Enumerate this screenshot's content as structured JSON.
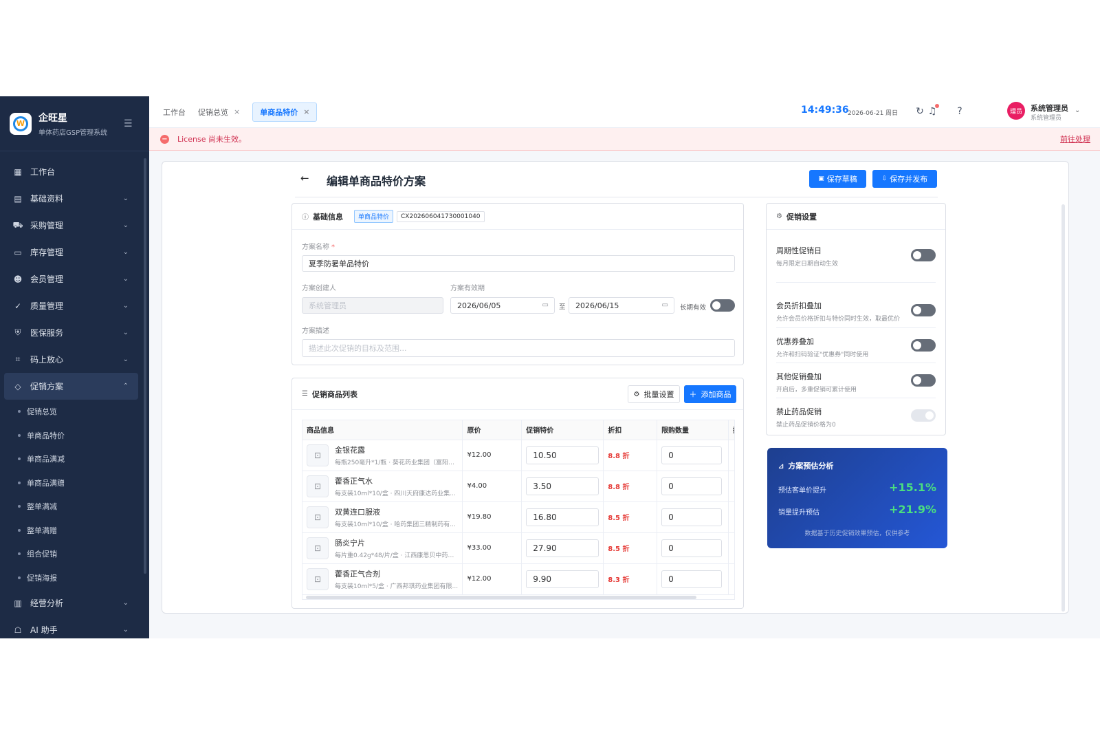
{
  "brand": {
    "name": "企旺星",
    "subtitle": "单体药店GSP管理系统"
  },
  "sidebar": {
    "items": [
      {
        "label": "工作台",
        "icon": "dashboard-icon"
      },
      {
        "label": "基础资料",
        "icon": "grid-icon"
      },
      {
        "label": "采购管理",
        "icon": "cart-icon"
      },
      {
        "label": "库存管理",
        "icon": "inventory-icon"
      },
      {
        "label": "会员管理",
        "icon": "users-icon"
      },
      {
        "label": "质量管理",
        "icon": "check-badge-icon"
      },
      {
        "label": "医保服务",
        "icon": "shield-icon"
      },
      {
        "label": "码上放心",
        "icon": "qr-icon"
      },
      {
        "label": "促销方案",
        "icon": "tag-icon"
      }
    ],
    "promo_sub": [
      "促销总览",
      "单商品特价",
      "单商品满减",
      "单商品满赠",
      "整单满减",
      "整单满赠",
      "组合促销",
      "促销海报"
    ],
    "bottom_items": [
      {
        "label": "经营分析",
        "icon": "chart-icon"
      },
      {
        "label": "AI 助手",
        "icon": "robot-icon"
      }
    ]
  },
  "tabs": [
    {
      "label": "工作台"
    },
    {
      "label": "促销总览"
    },
    {
      "label": "单商品特价"
    }
  ],
  "header": {
    "time": "14:49:36",
    "date": "2026-06-21 周日",
    "avatar_text": "理员",
    "user_name": "系统管理员",
    "user_role": "系统管理员"
  },
  "alert": {
    "text": "License 尚未生效。",
    "link": "前往处理"
  },
  "page": {
    "title": "编辑单商品特价方案",
    "save_draft": "保存草稿",
    "save_publish": "保存并发布"
  },
  "basic": {
    "title": "基础信息",
    "type_tag": "单商品特价",
    "code": "CX202606041730001040",
    "name_label": "方案名称",
    "name_value": "夏季防暑单品特价",
    "creator_label": "方案创建人",
    "creator_value": "系统管理员",
    "period_label": "方案有效期",
    "start_date": "2026/06/05",
    "to": "至",
    "end_date": "2026/06/15",
    "long_term": "长期有效",
    "desc_label": "方案描述",
    "desc_placeholder": "描述此次促销的目标及范围..."
  },
  "list": {
    "title": "促销商品列表",
    "batch": "批量设置",
    "add": "添加商品",
    "headers": [
      "商品信息",
      "原价",
      "促销特价",
      "折扣",
      "限购数量",
      "操"
    ],
    "rows": [
      {
        "name": "金银花露",
        "spec": "每瓶250毫升*1/瓶 · 葵花药业集团（富阳）...",
        "price": "¥12.00",
        "promo": "10.50",
        "discount": "8.8 折",
        "limit": "0"
      },
      {
        "name": "藿香正气水",
        "spec": "每支装10ml*10/盒 · 四川天府康达药业集...",
        "price": "¥4.00",
        "promo": "3.50",
        "discount": "8.8 折",
        "limit": "0"
      },
      {
        "name": "双黄连口服液",
        "spec": "每支装10ml*10/盒 · 哈药集团三精制药有...",
        "price": "¥19.80",
        "promo": "16.80",
        "discount": "8.5 折",
        "limit": "0"
      },
      {
        "name": "肠炎宁片",
        "spec": "每片重0.42g*48/片/盒 · 江西康恩贝中药有...",
        "price": "¥33.00",
        "promo": "27.90",
        "discount": "8.5 折",
        "limit": "0"
      },
      {
        "name": "藿香正气合剂",
        "spec": "每支装10ml*5/盒 · 广西邦琪药业集团有限...",
        "price": "¥12.00",
        "promo": "9.90",
        "discount": "8.3 折",
        "limit": "0"
      }
    ]
  },
  "settings": {
    "title": "促销设置",
    "items": [
      {
        "title": "周期性促销日",
        "desc": "每月限定日期自动生效"
      },
      {
        "title": "会员折扣叠加",
        "desc": "允许会员价格折扣与特价同时生效，取最优价"
      },
      {
        "title": "优惠券叠加",
        "desc": "允许和扫码验证\"优惠券\"同时使用"
      },
      {
        "title": "其他促销叠加",
        "desc": "开启后，多重促销可累计使用"
      },
      {
        "title": "禁止药品促销",
        "desc": "禁止药品促销价格为0"
      }
    ]
  },
  "analysis": {
    "title": "方案预估分析",
    "rows": [
      {
        "label": "预估客单价提升",
        "value": "+15.1%"
      },
      {
        "label": "销量提升预估",
        "value": "+21.9%"
      }
    ],
    "note": "数据基于历史促销效果预估，仅供参考"
  },
  "colors": {
    "primary": "#1677ff",
    "sidebar": "#1d2b45",
    "danger": "#e53935",
    "success": "#4ade80"
  }
}
